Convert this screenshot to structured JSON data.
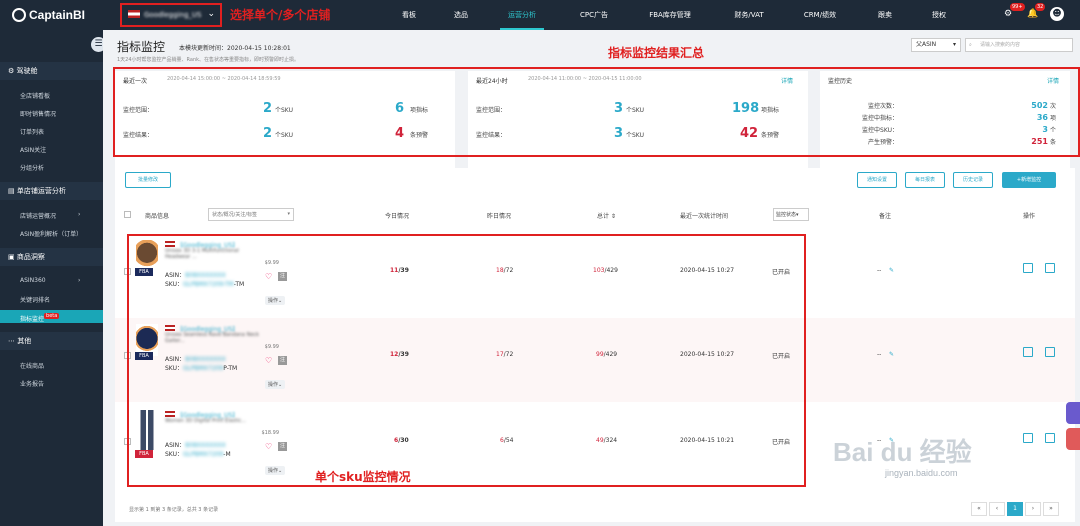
{
  "brand": {
    "logo": "CaptainBI"
  },
  "shop": {
    "name": "Goodlegging_US",
    "tip": "选择单个/多个店铺"
  },
  "nav": [
    "看板",
    "选品",
    "运营分析",
    "CPC广告",
    "FBA库存管理",
    "财务/VAT",
    "CRM/绩效",
    "跟卖",
    "授权"
  ],
  "topicons": {
    "settings_badge": "99+",
    "bell_badge": "32"
  },
  "sidebar": {
    "groups": [
      "驾驶舱",
      "单店铺运营分析",
      "商品洞察",
      "其他"
    ],
    "cockpit": [
      "全店铺看板",
      "即时销售情况",
      "订单列表",
      "ASIN关注",
      "分组分析"
    ],
    "single": [
      "店铺运营概况",
      "ASIN盈利解析（订单）"
    ],
    "insight": [
      "ASIN360",
      "关键词排名",
      "指标监控"
    ],
    "insight_active_badge": "beta",
    "other": [
      "在线商品",
      "业务报告"
    ]
  },
  "page": {
    "title": "指标监控",
    "update": "本模块更新时间：2020-04-15 10:28:01",
    "note": "1天24小时帮您监控产品销量、Rank、在售状态等重要指标，即时预警即时止损。",
    "summary_tip": "指标监控结果汇总",
    "asin_select": "父ASIN",
    "search_placeholder": "请输入搜索的内容"
  },
  "panels": {
    "latest": {
      "title": "最近一次",
      "time": "2020-04-14 15:00:00 ~ 2020-04-14 18:59:59",
      "scope_label": "监控范围：",
      "scope_sku": "2",
      "scope_sku_unit": "个SKU",
      "scope_idx": "6",
      "scope_idx_unit": "项指标",
      "result_label": "监控结果：",
      "result_sku": "2",
      "result_sku_unit": "个SKU",
      "result_alert": "4",
      "result_alert_unit": "条预警"
    },
    "day": {
      "title": "最近24小时",
      "time": "2020-04-14 11:00:00 ~ 2020-04-15 11:00:00",
      "link": "详情",
      "scope_label": "监控范围：",
      "scope_sku": "3",
      "scope_sku_unit": "个SKU",
      "scope_idx": "198",
      "scope_idx_unit": "项指标",
      "result_label": "监控结果：",
      "result_sku": "3",
      "result_sku_unit": "个SKU",
      "result_alert": "42",
      "result_alert_unit": "条预警"
    },
    "history": {
      "title": "监控历史",
      "link": "详情",
      "rows": [
        {
          "label": "监控次数：",
          "value": "502",
          "unit": "次"
        },
        {
          "label": "监控中指标：",
          "value": "36",
          "unit": "项"
        },
        {
          "label": "监控中SKU：",
          "value": "3",
          "unit": "个"
        },
        {
          "label": "产生预警：",
          "value": "251",
          "unit": "条"
        }
      ]
    }
  },
  "toolbar": {
    "batch": "批量修改",
    "notify": "通知设置",
    "daily": "每日报表",
    "history": "历史记录",
    "add": "+新增监控"
  },
  "table": {
    "headers": {
      "product": "商品信息",
      "filter": "状态/概况/关注/标签",
      "today": "今日情况",
      "yesterday": "昨日情况",
      "total": "总计",
      "last": "最近一次统计时间",
      "status": "监控状态",
      "note": "备注",
      "action": "操作"
    },
    "rows": [
      {
        "shop": "【Goodlegging_US】",
        "title": "Unisex 3D 3-1 Multifunctional Headwear ...",
        "price": "$9.99",
        "asin_label": "ASIN：",
        "asin": "B08XXXXXXX",
        "sku_label": "SKU：",
        "sku": "GLPBMX7209-TM",
        "sku_suffix": "-TM",
        "op": "操作",
        "today_a": "11",
        "today_b": "/39",
        "yest_a": "18",
        "yest_b": "/72",
        "total_a": "103",
        "total_b": "/429",
        "last": "2020-04-15 10:27",
        "status": "已开启",
        "note": "--",
        "fba": "FBA"
      },
      {
        "shop": "【Goodlegging_US】",
        "title": "Unisex Seamless Rave Bandana Neck Gaiter...",
        "price": "$9.99",
        "asin_label": "ASIN：",
        "asin": "B08XXXXXXX",
        "sku_label": "SKU：",
        "sku": "GLPBMX7209",
        "sku_suffix": "P-TM",
        "op": "操作",
        "today_a": "12",
        "today_b": "/39",
        "yest_a": "17",
        "yest_b": "/72",
        "total_a": "99",
        "total_b": "/429",
        "last": "2020-04-15 10:27",
        "status": "已开启",
        "note": "--",
        "fba": "FBA"
      },
      {
        "shop": "【Goodlegging_US】",
        "title": "Women 3D Digital Print Elastic...",
        "price": "$18.99",
        "asin_label": "ASIN：",
        "asin": "B08XXXXXXX",
        "sku_label": "SKU：",
        "sku": "GLPBMX7209",
        "sku_suffix": "-M",
        "op": "操作",
        "today_a": "6",
        "today_b": "/30",
        "yest_a": "6",
        "yest_b": "/54",
        "total_a": "49",
        "total_b": "/324",
        "last": "2020-04-15 10:21",
        "status": "已开启",
        "note": "--",
        "fba": "FBA"
      }
    ],
    "sku_tip": "单个sku监控情况",
    "pager_text": "显示第 1 到第 3 条记录，总共 3 条记录",
    "pages": [
      "«",
      "‹",
      "1",
      "›",
      "»"
    ]
  },
  "watermark": {
    "main": "Bai du 经验",
    "sub": "jingyan.baidu.com"
  },
  "colors": {
    "accent": "#2ba9c9",
    "alert": "#d0233a",
    "annotation": "#e02020",
    "sidebar": "#1e2a38"
  }
}
